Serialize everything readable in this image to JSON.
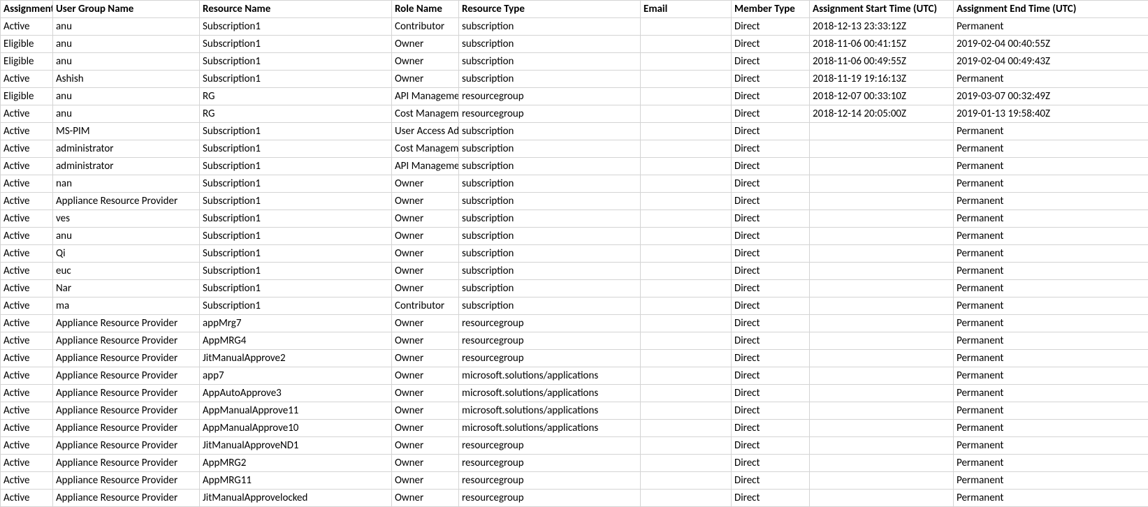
{
  "headers": [
    "Assignment",
    "User Group Name",
    "Resource Name",
    "Role Name",
    "Resource Type",
    "Email",
    "Member Type",
    "Assignment Start Time (UTC)",
    "Assignment End Time (UTC)"
  ],
  "rows": [
    {
      "c": [
        "Active",
        "anu",
        "Subscription1",
        "Contributor",
        "subscription",
        "",
        "Direct",
        "2018-12-13 23:33:12Z",
        "Permanent"
      ]
    },
    {
      "c": [
        "Eligible",
        "anu",
        "Subscription1",
        "Owner",
        "subscription",
        "",
        "Direct",
        "2018-11-06 00:41:15Z",
        "2019-02-04 00:40:55Z"
      ]
    },
    {
      "c": [
        "Eligible",
        "anu",
        "Subscription1",
        "Owner",
        "subscription",
        "",
        "Direct",
        "2018-11-06 00:49:55Z",
        "2019-02-04 00:49:43Z"
      ]
    },
    {
      "c": [
        "Active",
        "Ashish",
        "Subscription1",
        "Owner",
        "subscription",
        "",
        "Direct",
        "2018-11-19 19:16:13Z",
        "Permanent"
      ]
    },
    {
      "c": [
        "Eligible",
        "anu",
        "RG",
        "API Management",
        "resourcegroup",
        "",
        "Direct",
        "2018-12-07 00:33:10Z",
        "2019-03-07 00:32:49Z"
      ]
    },
    {
      "c": [
        "Active",
        "anu",
        "RG",
        "Cost Management",
        "resourcegroup",
        "",
        "Direct",
        "2018-12-14 20:05:00Z",
        "2019-01-13 19:58:40Z"
      ]
    },
    {
      "c": [
        "Active",
        "MS-PIM",
        "Subscription1",
        "User Access Administrator",
        "subscription",
        "",
        "Direct",
        "",
        "Permanent"
      ]
    },
    {
      "c": [
        "Active",
        "administrator",
        "Subscription1",
        "Cost Management",
        "subscription",
        "",
        "Direct",
        "",
        "Permanent"
      ]
    },
    {
      "c": [
        "Active",
        "administrator",
        "Subscription1",
        "API Management",
        "subscription",
        "",
        "Direct",
        "",
        "Permanent"
      ]
    },
    {
      "c": [
        "Active",
        "nan",
        "Subscription1",
        "Owner",
        "subscription",
        "",
        "Direct",
        "",
        "Permanent"
      ]
    },
    {
      "c": [
        "Active",
        "Appliance Resource Provider",
        "Subscription1",
        "Owner",
        "subscription",
        "",
        "Direct",
        "",
        "Permanent"
      ]
    },
    {
      "c": [
        "Active",
        "ves",
        "Subscription1",
        "Owner",
        "subscription",
        "",
        "Direct",
        "",
        "Permanent"
      ]
    },
    {
      "c": [
        "Active",
        "anu",
        "Subscription1",
        "Owner",
        "subscription",
        "",
        "Direct",
        "",
        "Permanent"
      ]
    },
    {
      "c": [
        "Active",
        "Qi",
        "Subscription1",
        "Owner",
        "subscription",
        "",
        "Direct",
        "",
        "Permanent"
      ]
    },
    {
      "c": [
        "Active",
        "euc",
        "Subscription1",
        "Owner",
        "subscription",
        "",
        "Direct",
        "",
        "Permanent"
      ]
    },
    {
      "c": [
        "Active",
        "Nar",
        "Subscription1",
        "Owner",
        "subscription",
        "",
        "Direct",
        "",
        "Permanent"
      ]
    },
    {
      "c": [
        "Active",
        "ma",
        "Subscription1",
        "Contributor",
        "subscription",
        "",
        "Direct",
        "",
        "Permanent"
      ]
    },
    {
      "c": [
        "Active",
        "Appliance Resource Provider",
        "appMrg7",
        "Owner",
        "resourcegroup",
        "",
        "Direct",
        "",
        "Permanent"
      ]
    },
    {
      "c": [
        "Active",
        "Appliance Resource Provider",
        "AppMRG4",
        "Owner",
        "resourcegroup",
        "",
        "Direct",
        "",
        "Permanent"
      ]
    },
    {
      "c": [
        "Active",
        "Appliance Resource Provider",
        "JitManualApprove2",
        "Owner",
        "resourcegroup",
        "",
        "Direct",
        "",
        "Permanent"
      ]
    },
    {
      "c": [
        "Active",
        "Appliance Resource Provider",
        "app7",
        "Owner",
        "microsoft.solutions/applications",
        "",
        "Direct",
        "",
        "Permanent"
      ]
    },
    {
      "c": [
        "Active",
        "Appliance Resource Provider",
        "AppAutoApprove3",
        "Owner",
        "microsoft.solutions/applications",
        "",
        "Direct",
        "",
        "Permanent"
      ]
    },
    {
      "c": [
        "Active",
        "Appliance Resource Provider",
        "AppManualApprove11",
        "Owner",
        "microsoft.solutions/applications",
        "",
        "Direct",
        "",
        "Permanent"
      ]
    },
    {
      "c": [
        "Active",
        "Appliance Resource Provider",
        "AppManualApprove10",
        "Owner",
        "microsoft.solutions/applications",
        "",
        "Direct",
        "",
        "Permanent"
      ]
    },
    {
      "c": [
        "Active",
        "Appliance Resource Provider",
        "JitManualApproveND1",
        "Owner",
        "resourcegroup",
        "",
        "Direct",
        "",
        "Permanent"
      ]
    },
    {
      "c": [
        "Active",
        "Appliance Resource Provider",
        "AppMRG2",
        "Owner",
        "resourcegroup",
        "",
        "Direct",
        "",
        "Permanent"
      ]
    },
    {
      "c": [
        "Active",
        "Appliance Resource Provider",
        "AppMRG11",
        "Owner",
        "resourcegroup",
        "",
        "Direct",
        "",
        "Permanent"
      ]
    },
    {
      "c": [
        "Active",
        "Appliance Resource Provider",
        "JitManualApprovelocked",
        "Owner",
        "resourcegroup",
        "",
        "Direct",
        "",
        "Permanent"
      ]
    }
  ]
}
